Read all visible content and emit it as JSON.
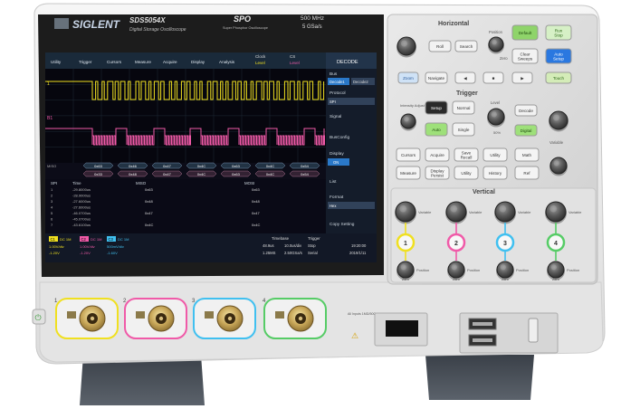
{
  "header": {
    "brand": "SIGLENT",
    "model": "SDS5054X",
    "subtitle": "Digital Storage Oscilloscope",
    "spo": "SPO",
    "spo_sub": "Super Phosphor Oscilloscope",
    "bandwidth": "500 MHz",
    "sample_rate": "5 GSa/s"
  },
  "screen": {
    "menu": [
      "Utility",
      "Trigger",
      "Cursors",
      "Measure",
      "Acquire",
      "Display",
      "Analysis"
    ],
    "top_clock_label": "Clock",
    "top_clock_val": "Level",
    "top_cs_label": "CS",
    "top_cs_val": "Level",
    "decode_title": "DECODE",
    "side_menu": {
      "bus_label": "Bus",
      "bus_opt1": "Decode1",
      "bus_opt2": "Decode2",
      "protocol_label": "Protocol",
      "protocol_val": "SPI",
      "signal_label": "Signal",
      "busconfig_label": "BusConfig",
      "display_label": "Display",
      "display_val": "ON",
      "list_label": "List",
      "format_label": "Format",
      "format_val": "Hex",
      "copy_label": "Copy Setting"
    },
    "decode_row_label": "MISO",
    "decode_boxes": [
      "0x63",
      "0x46",
      "0x47",
      "0x4C",
      "0x63",
      "0x4C",
      "0x54"
    ],
    "decode_boxes2": [
      "0x33",
      "0x48",
      "0x47",
      "0x4C",
      "0x63",
      "0x4C",
      "0x54"
    ],
    "table_headers": [
      "SPI",
      "Time",
      "MISO",
      "MOSI"
    ],
    "table_rows": [
      {
        "idx": "1",
        "time": "-29.8000us",
        "miso": "0x63",
        "mosi": "0x63"
      },
      {
        "idx": "2",
        "time": "-28.9000us",
        "miso": "",
        "mosi": ""
      },
      {
        "idx": "3",
        "time": "-27.6000us",
        "miso": "0x48",
        "mosi": "0x48"
      },
      {
        "idx": "4",
        "time": "-27.6000us",
        "miso": "",
        "mosi": ""
      },
      {
        "idx": "5",
        "time": "-46.0700us",
        "miso": "0x47",
        "mosi": "0x47"
      },
      {
        "idx": "6",
        "time": "-45.0700us",
        "miso": "",
        "mosi": ""
      },
      {
        "idx": "7",
        "time": "-43.6100us",
        "miso": "0x4C",
        "mosi": "0x4C"
      }
    ],
    "ch_info": {
      "c1_label": "C1",
      "c1_mode": "DC 1M",
      "c1_scale": "1.00V/div",
      "c1_offset": "-1.20V",
      "c2_label": "C2",
      "c2_mode": "DC 1M",
      "c2_scale": "1.00V/div",
      "c2_offset": "-1.20V",
      "c3_label": "C3",
      "c3_mode": "DC 1M",
      "c3_scale": "500mV/div",
      "c3_offset": "-1.60V"
    },
    "timebase_label": "Timebase",
    "timebase_delay": "48.9us",
    "timebase_scale": "10.0us/div",
    "timebase_mem": "1.25MS",
    "timebase_rate": "2.50GSa/s",
    "trigger_label": "Trigger",
    "trigger_mode": "Stop",
    "trigger_type": "Serial",
    "clock_time": "19:20:00",
    "clock_date": "2019/1/11"
  },
  "horizontal": {
    "title": "Horizontal",
    "buttons": [
      "Roll",
      "Search",
      "Zoom",
      "Navigate"
    ],
    "knob_labels": [
      "Position",
      "Zero"
    ]
  },
  "top_right_buttons": [
    "Default",
    "Run\nStop",
    "Clear\nSweeps",
    "Auto\nSetup",
    "Touch"
  ],
  "trigger_panel": {
    "title": "Trigger",
    "intensity_label": "Intensity Adjust",
    "setup_label": "Setup",
    "normal_label": "Normal",
    "level_label": "Level",
    "auto_label": "Auto",
    "single_label": "Single",
    "level_sub": "50%",
    "decode_label": "Decode",
    "digital_label": "Digital",
    "variable_label": "Variable"
  },
  "function_buttons": [
    "Cursors",
    "Acquire",
    "Save\nRecall",
    "Utility",
    "Measure",
    "Display\nPersist",
    "Utility",
    "History",
    "Math",
    "Ref"
  ],
  "vertical": {
    "title": "Vertical",
    "channel_numbers": [
      "1",
      "2",
      "3",
      "4"
    ],
    "variable_label": "Variable",
    "position_label": "Position",
    "zero_label": "Zero"
  },
  "front": {
    "input_numbers": [
      "1",
      "2",
      "3",
      "4"
    ],
    "input_spec": "All Inputs 1MΩ/50Ω 400Vpk",
    "warning": "⚠"
  },
  "colors": {
    "ch1": "#f0e020",
    "ch2": "#f05aa8",
    "ch3": "#40c0f0",
    "ch4": "#56cc66",
    "chassis": "#eeeeee",
    "bezel": "#1c1c1c",
    "screen_bg": "#0a0a14"
  }
}
